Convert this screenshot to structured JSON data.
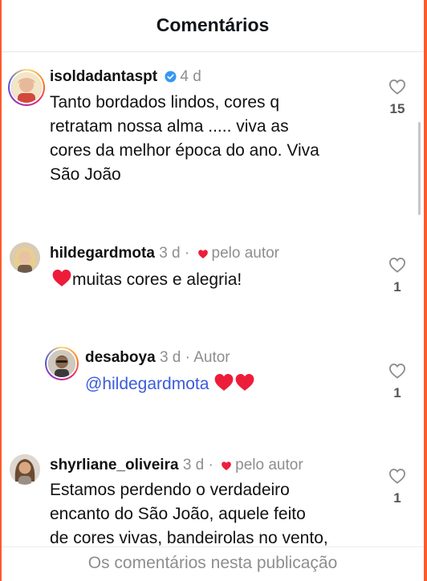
{
  "header": {
    "title": "Comentários"
  },
  "comments": [
    {
      "username": "isoldadantaspt",
      "verified": true,
      "time": "4 d",
      "text_lines": [
        "Tanto bordados lindos, cores q",
        "retratam nossa alma ..... viva as",
        "cores da melhor época do ano. Viva",
        "São João"
      ],
      "likes": "15"
    },
    {
      "username": "hildegardmota",
      "time": "3 d",
      "separator": "·",
      "liked_by_author": "pelo autor",
      "text": "muitas cores  e alegria!",
      "likes": "1"
    },
    {
      "username": "desaboya",
      "time": "3 d",
      "separator": "·",
      "role": "Autor",
      "mention": "@hildegardmota",
      "likes": "1"
    },
    {
      "username": "shyrliane_oliveira",
      "time": "3 d",
      "separator": "·",
      "liked_by_author": "pelo autor",
      "text_lines": [
        "Estamos perdendo o verdadeiro",
        "encanto do São João, aquele feito",
        "de cores vivas, bandeirolas no vento,"
      ],
      "likes": "1"
    }
  ],
  "footer": {
    "text": "Os comentários nesta publicação"
  },
  "colors": {
    "heart_red": "#ed1d3a",
    "verified_blue": "#3797f0",
    "mention_blue": "#3b5bdb"
  }
}
